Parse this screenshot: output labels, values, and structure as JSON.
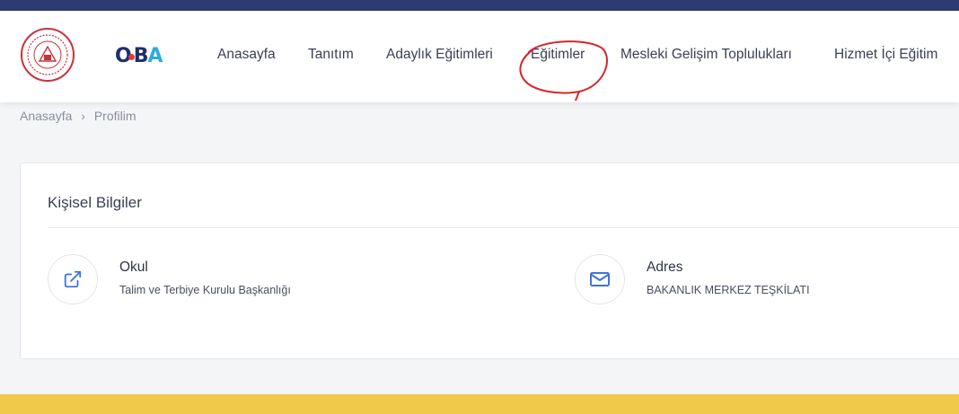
{
  "nav": {
    "items": [
      {
        "label": "Anasayfa"
      },
      {
        "label": "Tanıtım"
      },
      {
        "label": "Adaylık Eğitimleri"
      },
      {
        "label": "Eğitimler"
      },
      {
        "label": "Mesleki Gelişim Toplulukları"
      },
      {
        "label": "Hizmet İçi Eğitim"
      }
    ]
  },
  "logo": {
    "oba_o": "O",
    "oba_b": "B",
    "oba_a": "A"
  },
  "breadcrumb": {
    "home": "Anasayfa",
    "separator": "›",
    "current": "Profilim"
  },
  "profile": {
    "title": "Kişisel Bilgiler",
    "fields": [
      {
        "label": "Okul",
        "value": "Talim ve Terbiye Kurulu Başkanlığı",
        "icon": "external-link-icon"
      },
      {
        "label": "Adres",
        "value": "BAKANLIK MERKEZ TEŞKİLATI",
        "icon": "envelope-icon"
      }
    ]
  },
  "colors": {
    "top_bar": "#2c3c70",
    "accent_blue": "#3f73d8",
    "annotation_red": "#d8252b",
    "footer": "#f0c84a"
  }
}
